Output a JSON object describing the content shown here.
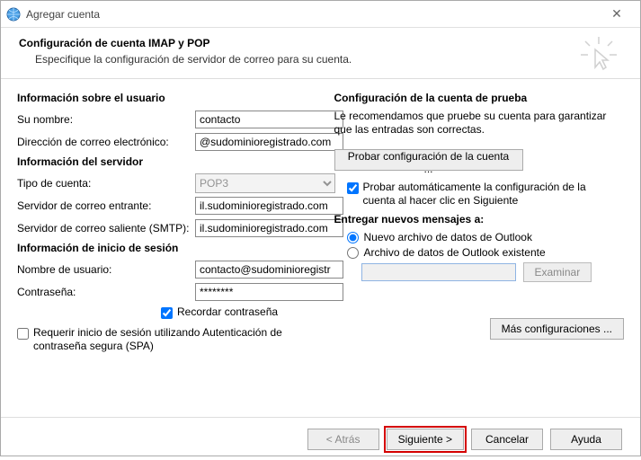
{
  "window": {
    "title": "Agregar cuenta"
  },
  "header": {
    "title": "Configuración de cuenta IMAP y POP",
    "subtitle": "Especifique la configuración de servidor de correo para su cuenta."
  },
  "left": {
    "userInfoTitle": "Información sobre el usuario",
    "yourNameLabel": "Su nombre:",
    "yourNameValue": "contacto",
    "emailLabel": "Dirección de correo electrónico:",
    "emailValue": "@sudominioregistrado.com",
    "serverInfoTitle": "Información del servidor",
    "accountTypeLabel": "Tipo de cuenta:",
    "accountTypeValue": "POP3",
    "incomingLabel": "Servidor de correo entrante:",
    "incomingValue": "il.sudominioregistrado.com",
    "outgoingLabel": "Servidor de correo saliente (SMTP):",
    "outgoingValue": "il.sudominioregistrado.com",
    "loginInfoTitle": "Información de inicio de sesión",
    "usernameLabel": "Nombre de usuario:",
    "usernameValue": "contacto@sudominioregistr",
    "passwordLabel": "Contraseña:",
    "passwordValue": "********",
    "rememberLabel": "Recordar contraseña",
    "spaLabel": "Requerir inicio de sesión utilizando Autenticación de contraseña segura (SPA)"
  },
  "right": {
    "testTitle": "Configuración de la cuenta de prueba",
    "testDesc": "Le recomendamos que pruebe su cuenta para garantizar que las entradas son correctas.",
    "testBtn": "Probar configuración de la cuenta ...",
    "autoTestLabel": "Probar automáticamente la configuración de la cuenta al hacer clic en Siguiente",
    "deliverTitle": "Entregar nuevos mensajes a:",
    "radioNew": "Nuevo archivo de datos de Outlook",
    "radioExisting": "Archivo de datos de Outlook existente",
    "browseBtn": "Examinar",
    "moreBtn": "Más configuraciones ..."
  },
  "footer": {
    "back": "< Atrás",
    "next": "Siguiente >",
    "cancel": "Cancelar",
    "help": "Ayuda"
  }
}
